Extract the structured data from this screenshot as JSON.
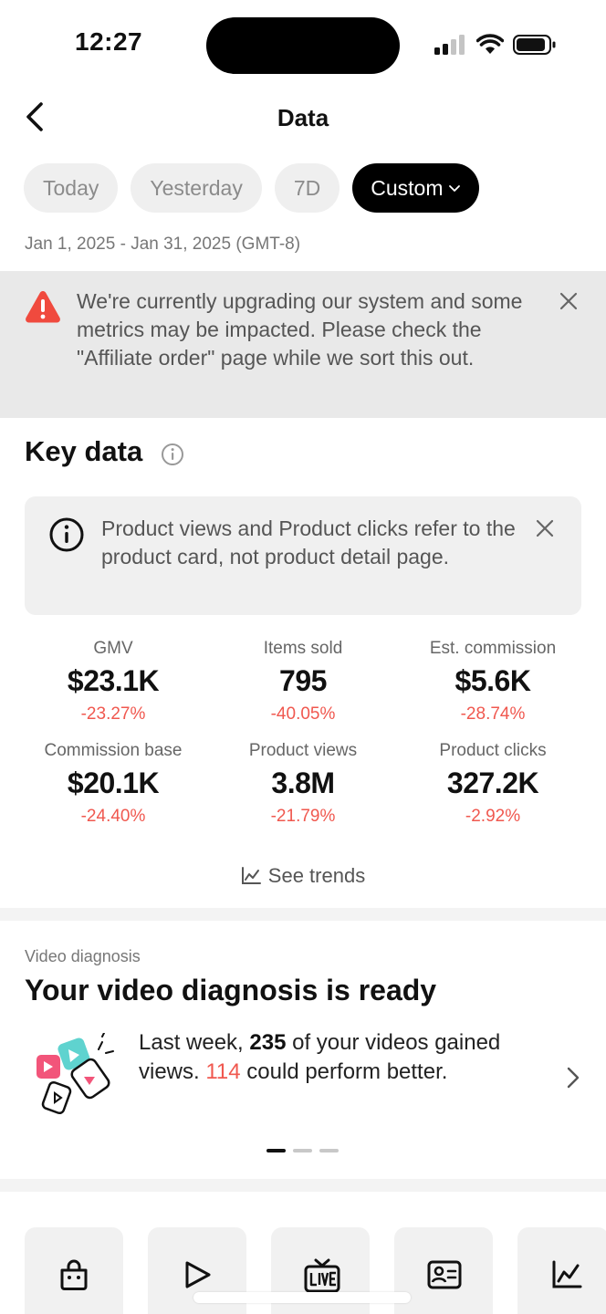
{
  "status_bar": {
    "time": "12:27"
  },
  "header": {
    "title": "Data"
  },
  "tabs": [
    {
      "label": "Today"
    },
    {
      "label": "Yesterday"
    },
    {
      "label": "7D"
    },
    {
      "label": "Custom"
    }
  ],
  "date_range": "Jan 1, 2025 - Jan 31, 2025 (GMT-8)",
  "banner": {
    "text": "We're currently upgrading our system and some metrics may be impacted. Please check the \"Affiliate order\" page while we sort this out."
  },
  "key_data": {
    "title": "Key data",
    "note": "Product views and Product clicks refer to the product card, not product detail page.",
    "metrics": [
      {
        "label": "GMV",
        "value": "$23.1K",
        "change": "-23.27%"
      },
      {
        "label": "Items sold",
        "value": "795",
        "change": "-40.05%"
      },
      {
        "label": "Est. commission",
        "value": "$5.6K",
        "change": "-28.74%"
      },
      {
        "label": "Commission base",
        "value": "$20.1K",
        "change": "-24.40%"
      },
      {
        "label": "Product views",
        "value": "3.8M",
        "change": "-21.79%"
      },
      {
        "label": "Product clicks",
        "value": "327.2K",
        "change": "-2.92%"
      }
    ],
    "see_trends": "See trends"
  },
  "video_diagnosis": {
    "label": "Video diagnosis",
    "title": "Your video diagnosis is ready",
    "text_part1": "Last week, ",
    "videos_gained": "235",
    "text_part2": " of your videos gained views. ",
    "could_improve": "114",
    "text_part3": " could perform better."
  },
  "colors": {
    "accent_red": "#f0584f",
    "warning_red": "#f04a3e"
  },
  "bottom_tiles": [
    {
      "icon": "shopping-bag-icon"
    },
    {
      "icon": "play-icon"
    },
    {
      "icon": "live-icon"
    },
    {
      "icon": "id-card-icon"
    },
    {
      "icon": "line-chart-icon"
    }
  ]
}
